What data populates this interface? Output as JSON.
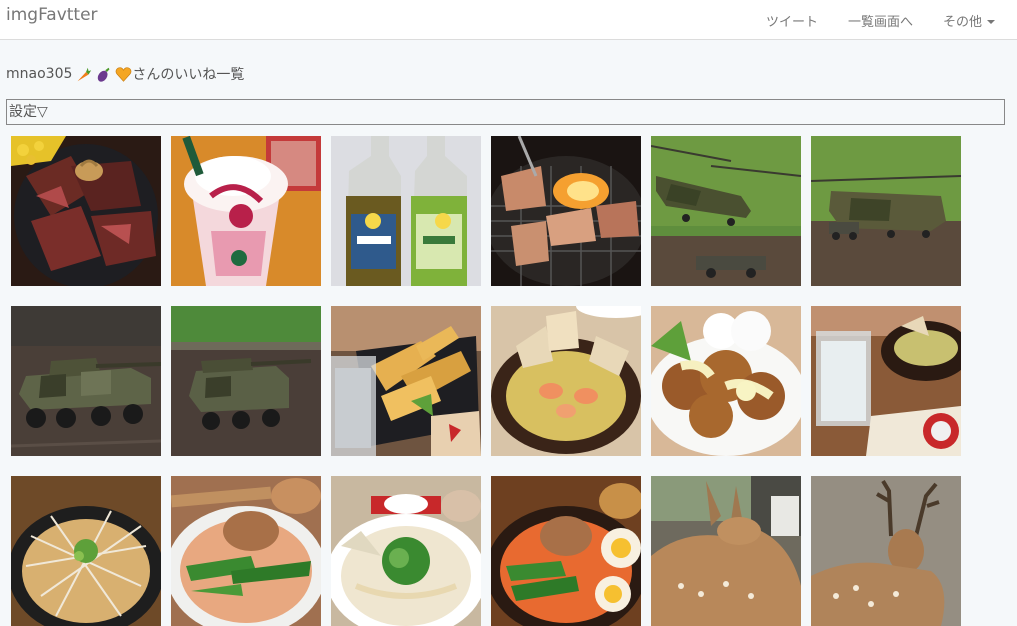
{
  "navbar": {
    "brand": "imgFavtter",
    "links": [
      {
        "label": "ツイート"
      },
      {
        "label": "一覧画面へ"
      },
      {
        "label": "その他",
        "has_caret": true
      }
    ]
  },
  "page": {
    "username": "mnao305",
    "title_suffix": "さんのいいね一覧",
    "name_emojis": [
      "carrot-emoji",
      "eggplant-emoji",
      "orange-heart-emoji"
    ]
  },
  "settings": {
    "label": "設定▽"
  },
  "images": [
    {
      "name": "steak-bowl-image"
    },
    {
      "name": "strawberry-frappuccino-image"
    },
    {
      "name": "milk-bottles-image"
    },
    {
      "name": "grilled-meat-image"
    },
    {
      "name": "chinook-helicopter-image"
    },
    {
      "name": "chinook-helicopter-2-image"
    },
    {
      "name": "combat-vehicle-image"
    },
    {
      "name": "combat-vehicle-2-image"
    },
    {
      "name": "tempura-image"
    },
    {
      "name": "ajillo-image"
    },
    {
      "name": "karaage-image"
    },
    {
      "name": "drink-and-dish-image"
    },
    {
      "name": "ramen-1-image"
    },
    {
      "name": "ramen-2-image"
    },
    {
      "name": "ramen-3-image"
    },
    {
      "name": "ramen-4-image"
    },
    {
      "name": "deer-1-image"
    },
    {
      "name": "deer-2-image"
    }
  ]
}
